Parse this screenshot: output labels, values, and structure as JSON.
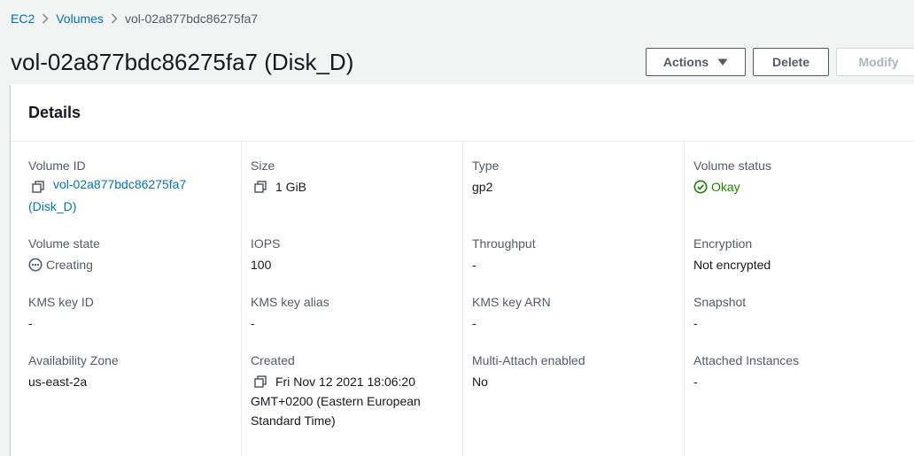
{
  "breadcrumb": {
    "items": [
      "EC2",
      "Volumes"
    ],
    "current": "vol-02a877bdc86275fa7"
  },
  "page": {
    "title": "vol-02a877bdc86275fa7 (Disk_D)"
  },
  "toolbar": {
    "actions_label": "Actions",
    "delete_label": "Delete",
    "modify_label": "Modify"
  },
  "details": {
    "title": "Details",
    "volume_id": {
      "label": "Volume ID",
      "value": "vol-02a877bdc86275fa7",
      "suffix": "(Disk_D)",
      "icon": "copy-icon"
    },
    "size": {
      "label": "Size",
      "value": "1 GiB",
      "icon": "copy-icon"
    },
    "type": {
      "label": "Type",
      "value": "gp2"
    },
    "volume_status": {
      "label": "Volume status",
      "value": "Okay",
      "icon": "check-circle-icon",
      "color": "#1d8102"
    },
    "volume_state": {
      "label": "Volume state",
      "value": "Creating",
      "icon": "pending-icon"
    },
    "iops": {
      "label": "IOPS",
      "value": "100"
    },
    "throughput": {
      "label": "Throughput",
      "value": "-"
    },
    "encryption": {
      "label": "Encryption",
      "value": "Not encrypted"
    },
    "kms_key_id": {
      "label": "KMS key ID",
      "value": "-"
    },
    "kms_key_alias": {
      "label": "KMS key alias",
      "value": "-"
    },
    "kms_key_arn": {
      "label": "KMS key ARN",
      "value": "-"
    },
    "snapshot": {
      "label": "Snapshot",
      "value": "-"
    },
    "availability_zone": {
      "label": "Availability Zone",
      "value": "us-east-2a"
    },
    "created": {
      "label": "Created",
      "value": "Fri Nov 12 2021 18:06:20",
      "value_line2": "GMT+0200 (Eastern European",
      "value_line3": "Standard Time)",
      "icon": "copy-icon"
    },
    "multi_attach": {
      "label": "Multi-Attach enabled",
      "value": "No"
    },
    "attached_instances": {
      "label": "Attached Instances",
      "value": "-"
    }
  },
  "colors": {
    "link": "#0073bb",
    "success": "#1d8102",
    "text": "#16191f",
    "label": "#545b64",
    "page_bg": "#f2f3f3"
  }
}
